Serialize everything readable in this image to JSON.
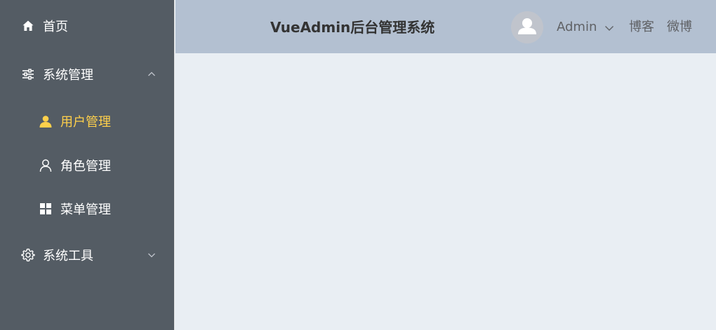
{
  "sidebar": {
    "items": [
      {
        "label": "首页",
        "icon": "home-icon"
      },
      {
        "label": "系统管理",
        "icon": "sliders-icon",
        "expanded": true,
        "children": [
          {
            "label": "用户管理",
            "icon": "user-filled-icon",
            "active": true
          },
          {
            "label": "角色管理",
            "icon": "user-outline-icon"
          },
          {
            "label": "菜单管理",
            "icon": "grid-icon"
          }
        ]
      },
      {
        "label": "系统工具",
        "icon": "gear-icon",
        "expanded": false
      }
    ]
  },
  "header": {
    "title": "VueAdmin后台管理系统",
    "user": {
      "name": "Admin"
    },
    "links": [
      "博客",
      "微博"
    ]
  },
  "colors": {
    "sidebar_bg": "#545c64",
    "active_text": "#ffd04b",
    "header_bg": "#b3c0d1",
    "main_bg": "#e9eef3"
  }
}
